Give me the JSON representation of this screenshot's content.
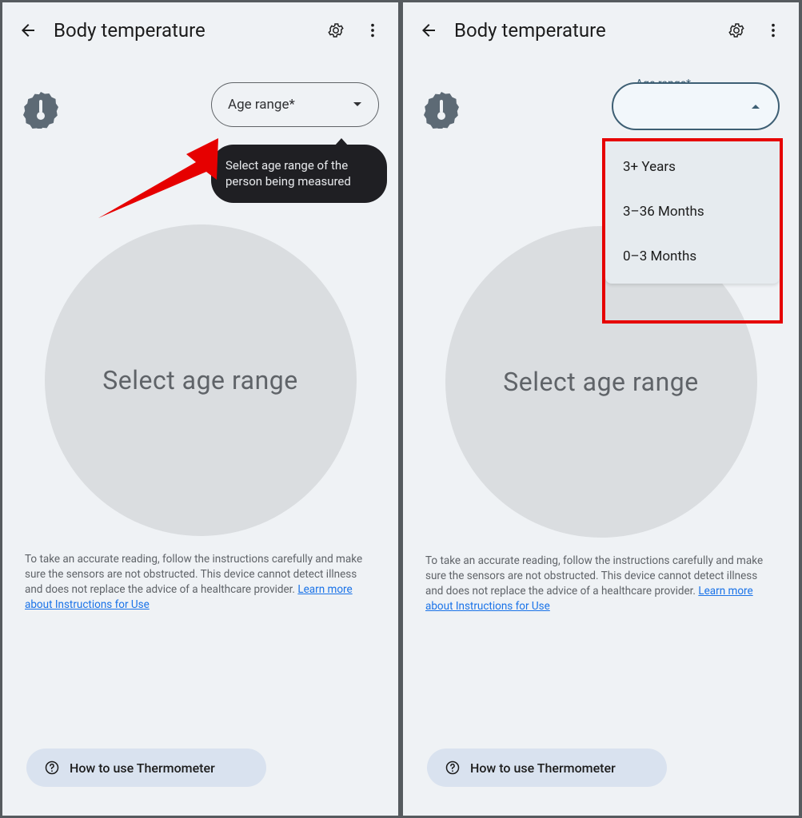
{
  "left": {
    "title": "Body temperature",
    "dropdown_label": "Age range*",
    "tooltip": "Select age range of the person being measured",
    "circle_text": "Select age range",
    "disclaimer_text": "To take an accurate reading, follow the instructions carefully and make sure the sensors are not obstructed. This device cannot detect illness and does not replace the advice of a healthcare provider. ",
    "disclaimer_link": "Learn more about Instructions for Use",
    "howto_label": "How to use Thermometer"
  },
  "right": {
    "title": "Body temperature",
    "dropdown_floating_label": "Age range*",
    "menu_options": [
      "3+ Years",
      "3–36 Months",
      "0–3 Months"
    ],
    "circle_text": "Select age range",
    "disclaimer_text": "To take an accurate reading, follow the instructions carefully and make sure the sensors are not obstructed. This device cannot detect illness and does not replace the advice of a healthcare provider. ",
    "disclaimer_link": "Learn more about Instructions for Use",
    "howto_label": "How to use Thermometer"
  }
}
